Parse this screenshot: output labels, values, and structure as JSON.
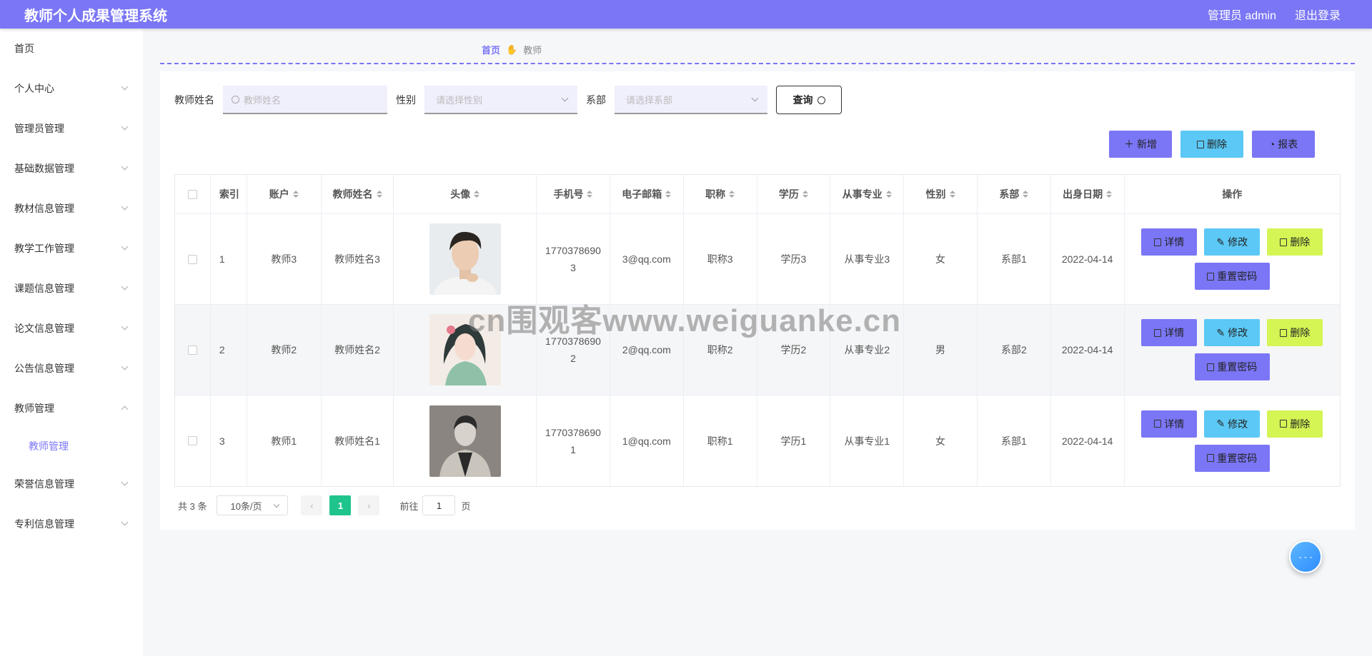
{
  "header": {
    "title": "教师个人成果管理系统",
    "user": "管理员 admin",
    "logout": "退出登录"
  },
  "sidebar": {
    "items": [
      {
        "label": "首页"
      },
      {
        "label": "个人中心"
      },
      {
        "label": "管理员管理"
      },
      {
        "label": "基础数据管理"
      },
      {
        "label": "教材信息管理"
      },
      {
        "label": "教学工作管理"
      },
      {
        "label": "课题信息管理"
      },
      {
        "label": "论文信息管理"
      },
      {
        "label": "公告信息管理"
      },
      {
        "label": "教师管理"
      },
      {
        "label": "荣誉信息管理"
      },
      {
        "label": "专利信息管理"
      }
    ],
    "sub_item": "教师管理"
  },
  "breadcrumb": {
    "home": "首页",
    "current": "教师"
  },
  "search": {
    "name_label": "教师姓名",
    "name_placeholder": "教师姓名",
    "gender_label": "性别",
    "gender_placeholder": "请选择性别",
    "dept_label": "系部",
    "dept_placeholder": "请选择系部",
    "query": "查询"
  },
  "actions": {
    "add": "新增",
    "delete": "删除",
    "report": "报表"
  },
  "table": {
    "headers": [
      "索引",
      "账户",
      "教师姓名",
      "头像",
      "手机号",
      "电子邮箱",
      "职称",
      "学历",
      "从事专业",
      "性别",
      "系部",
      "出身日期",
      "操作"
    ],
    "rows": [
      {
        "index": "1",
        "account": "教师3",
        "name": "教师姓名3",
        "phone": "17703786903",
        "email": "3@qq.com",
        "title": "职称3",
        "edu": "学历3",
        "major": "从事专业3",
        "gender": "女",
        "dept": "系部1",
        "birth": "2022-04-14"
      },
      {
        "index": "2",
        "account": "教师2",
        "name": "教师姓名2",
        "phone": "17703786902",
        "email": "2@qq.com",
        "title": "职称2",
        "edu": "学历2",
        "major": "从事专业2",
        "gender": "男",
        "dept": "系部2",
        "birth": "2022-04-14"
      },
      {
        "index": "3",
        "account": "教师1",
        "name": "教师姓名1",
        "phone": "17703786901",
        "email": "1@qq.com",
        "title": "职称1",
        "edu": "学历1",
        "major": "从事专业1",
        "gender": "女",
        "dept": "系部1",
        "birth": "2022-04-14"
      }
    ],
    "ops": {
      "detail": "详情",
      "edit": "修改",
      "delete": "删除",
      "reset": "重置密码"
    }
  },
  "pagination": {
    "total": "共 3 条",
    "page_size": "10条/页",
    "current": "1",
    "goto": "前往",
    "goto_value": "1",
    "page_unit": "页"
  },
  "watermark": "cn围观客www.weiguanke.cn",
  "colors": {
    "accent": "#7a76f5",
    "cyan": "#5bc8f5",
    "lime": "#d4f554",
    "page_active": "#1fc48d"
  }
}
